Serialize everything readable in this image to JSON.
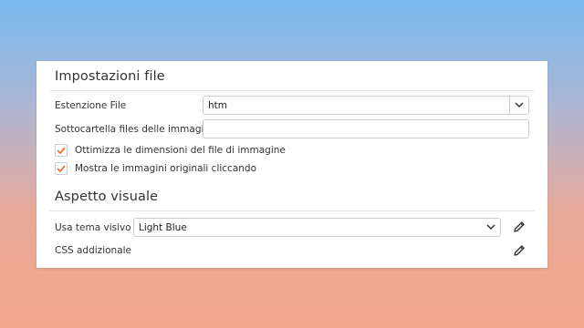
{
  "file_settings": {
    "title": "Impostazioni file",
    "extension": {
      "label": "Estenzione File",
      "value": "htm"
    },
    "images_subfolder": {
      "label": "Sottocartella files delle immagini",
      "value": ""
    },
    "optimize_images": {
      "label": "Ottimizza le dimensioni del file di immagine",
      "checked": true
    },
    "show_originals": {
      "label": "Mostra le immagini originali cliccando",
      "checked": true
    }
  },
  "appearance": {
    "title": "Aspetto visuale",
    "theme": {
      "label": "Usa tema visivo",
      "value": "Light Blue"
    },
    "custom_css": {
      "label": "CSS addizionale"
    }
  },
  "colors": {
    "check_accent": "#e8733a",
    "border": "#c9ced6"
  },
  "icons": [
    "chevron-down-icon",
    "check-icon",
    "pencil-icon"
  ]
}
